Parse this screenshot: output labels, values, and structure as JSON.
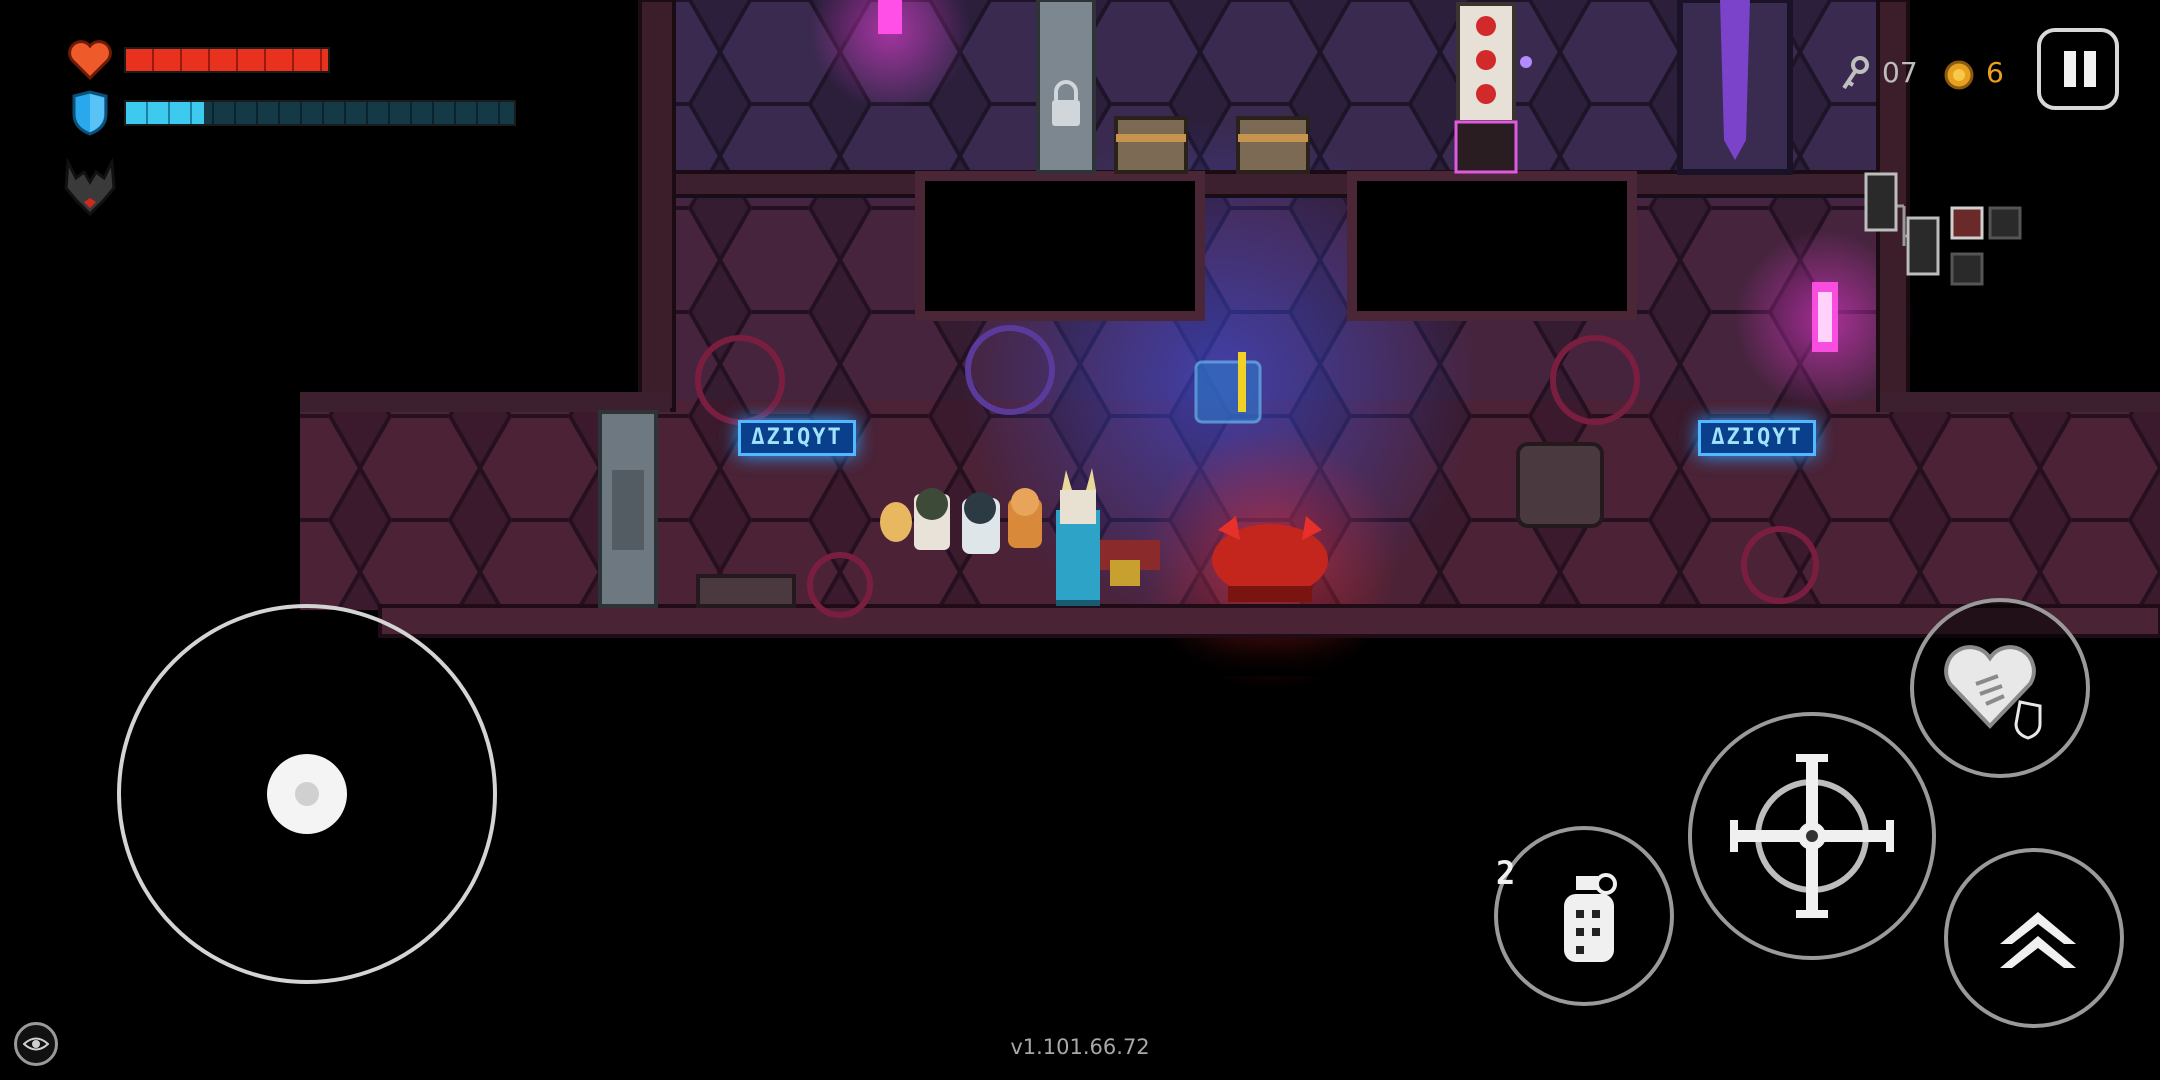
{
  "hud": {
    "health": {
      "icon": "heart-icon",
      "fill": 1.0,
      "color": "#e8321e"
    },
    "shield": {
      "icon": "shield-icon",
      "fill": 0.2,
      "color": "#3ec9ee"
    },
    "buff_icon": "demon-helmet-icon",
    "keys": {
      "icon": "key-icon",
      "count": "07"
    },
    "coins": {
      "icon": "coin-icon",
      "count": "6",
      "color": "#e8a020"
    },
    "pause_icon": "pause-icon"
  },
  "signs": {
    "left": "ΔZIQYT",
    "right": "ΔZIQYT"
  },
  "controls": {
    "joystick": "movement-joystick",
    "grenade_count": "2",
    "grenade_icon": "grenade-icon",
    "fire_icon": "crosshair-icon",
    "skill_icon": "heart-shield-icon",
    "jump_icon": "double-chevron-up-icon"
  },
  "minimap": {
    "rooms": 5
  },
  "settings_icon": "eye-settings-icon",
  "version": "v1.101.66.72"
}
